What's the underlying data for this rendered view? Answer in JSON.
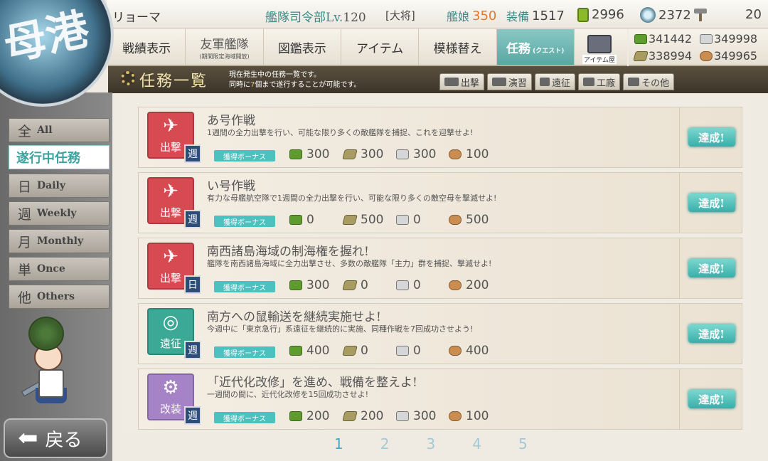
{
  "badge": {
    "text": "母港"
  },
  "header": {
    "admiral_name": "リョーマ",
    "hq_label": "艦隊司令部Lv.",
    "hq_level": "120",
    "rank": "[大将]",
    "ships_label": "艦娘",
    "ships_value": "350",
    "equip_label": "装備",
    "equip_value": "1517",
    "bucket_value": "2996",
    "devmat_value": "2372",
    "screw_value": "20"
  },
  "nav": {
    "items": [
      {
        "label": "戦績表示",
        "sub": ""
      },
      {
        "label": "友軍艦隊",
        "sub": "(期間限定海域開放)"
      },
      {
        "label": "図鑑表示",
        "sub": ""
      },
      {
        "label": "アイテム",
        "sub": ""
      },
      {
        "label": "模様替え",
        "sub": ""
      },
      {
        "label": "任務",
        "sub": "(クエスト)"
      }
    ],
    "item_shop_label": "アイテム屋"
  },
  "resources": {
    "fuel": "341442",
    "steel": "349998",
    "ammo": "338994",
    "bauxite": "349965"
  },
  "quest_header": {
    "title": "任務一覧",
    "desc_line1": "現在発生中の任務一覧です。",
    "desc_line2_pre": "同時に",
    "desc_line2_num": "7",
    "desc_line2_post": "個まで遂行することが可能です。",
    "tabs": [
      "出撃",
      "演習",
      "遠征",
      "工廠",
      "その他"
    ]
  },
  "filters": [
    {
      "kanji": "全",
      "en": "All"
    },
    {
      "label": "遂行中任務"
    },
    {
      "kanji": "日",
      "en": "Daily"
    },
    {
      "kanji": "週",
      "en": "Weekly"
    },
    {
      "kanji": "月",
      "en": "Monthly"
    },
    {
      "kanji": "単",
      "en": "Once"
    },
    {
      "kanji": "他",
      "en": "Others"
    }
  ],
  "back_label": "戻る",
  "bonus_label": "獲得ボーナス",
  "done_label": "達成!",
  "quests": [
    {
      "type": "sortie",
      "type_label": "出撃",
      "tag": "週",
      "title": "あ号作戦",
      "desc": "1週間の全力出撃を行い、可能な限り多くの敵艦隊を捕捉、これを迎撃せよ!",
      "fuel": "300",
      "ammo": "300",
      "steel": "300",
      "baux": "100"
    },
    {
      "type": "sortie",
      "type_label": "出撃",
      "tag": "週",
      "title": "い号作戦",
      "desc": "有力な母艦航空隊で1週間の全力出撃を行い、可能な限り多くの敵空母を撃滅せよ!",
      "fuel": "0",
      "ammo": "500",
      "steel": "0",
      "baux": "500"
    },
    {
      "type": "sortie",
      "type_label": "出撃",
      "tag": "日",
      "title": "南西諸島海域の制海権を握れ!",
      "desc": "艦隊を南西諸島海域に全力出撃させ、多数の敵艦隊「主力」群を捕捉、撃滅せよ!",
      "fuel": "300",
      "ammo": "0",
      "steel": "0",
      "baux": "200"
    },
    {
      "type": "expedition",
      "type_label": "遠征",
      "tag": "週",
      "title": "南方への鼠輸送を継続実施せよ!",
      "desc": "今週中に「東京急行」系遠征を継続的に実施、同種作戦を7回成功させよう!",
      "fuel": "400",
      "ammo": "0",
      "steel": "0",
      "baux": "400"
    },
    {
      "type": "modern",
      "type_label": "改装",
      "tag": "週",
      "title": "「近代化改修」を進め、戦備を整えよ!",
      "desc": "一週間の間に、近代化改修を15回成功させよ!",
      "fuel": "200",
      "ammo": "200",
      "steel": "300",
      "baux": "100"
    }
  ],
  "pages": [
    "1",
    "2",
    "3",
    "4",
    "5"
  ],
  "current_page": "1"
}
